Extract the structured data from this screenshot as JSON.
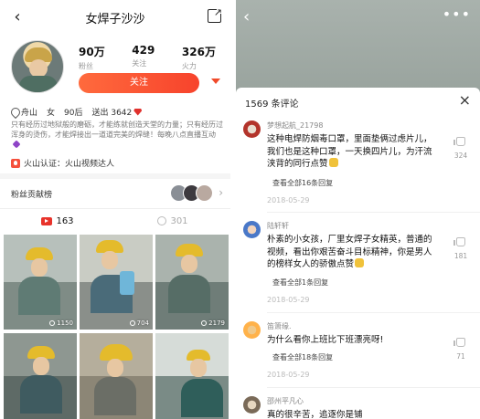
{
  "profile": {
    "nav_title": "女焊子沙沙",
    "stats": [
      {
        "num": "90万",
        "label": "粉丝"
      },
      {
        "num": "429",
        "label": "关注"
      },
      {
        "num": "326万",
        "label": "火力"
      }
    ],
    "follow_label": "关注",
    "info": {
      "location": "舟山",
      "gender": "女",
      "age": "90后",
      "sent": "送出 3642"
    },
    "bio": "只有经历过地狱般的磨砺，才能练就创造天堂的力量；只有经历过浑身的烫伤，才能焊接出一道道完美的焊缝！每晚八点直播互动",
    "cert": "火山认证：火山视频达人",
    "fans_label": "粉丝贡献榜",
    "tabs": [
      {
        "label": "163"
      },
      {
        "label": "301"
      }
    ],
    "thumbs": [
      {
        "count": "1150"
      },
      {
        "count": "704"
      },
      {
        "count": "2179"
      },
      {
        "count": ""
      },
      {
        "count": ""
      },
      {
        "count": ""
      }
    ]
  },
  "comments_panel": {
    "title": "1569 条评论",
    "comments": [
      {
        "user": "梦想起航_21798",
        "text": "这种电焊防烟毒口罩，里面垫俩过虑片儿，我们也是这种口罩，一天换四片儿，为汗流浃背的同行点赞",
        "reply": "查看全部16条回复",
        "time": "2018-05-29",
        "likes": "324"
      },
      {
        "user": "陆轩轩",
        "text": "朴素的小女孩，厂里女焊子女精英，普通的视频，看出你艰苦奋斗目标精神，你是男人的榜样女人的骄傲点赞",
        "reply": "查看全部1条回复",
        "time": "2018-05-29",
        "likes": "181"
      },
      {
        "user": "笛箫缘.",
        "text": "为什么看你上班比下班漂亮呀!",
        "reply": "查看全部18条回复",
        "time": "2018-05-29",
        "likes": "71"
      },
      {
        "user": "邵州平凡心",
        "text": "真的很辛苦，追逐你是铺",
        "reply": "",
        "time": "",
        "likes": ""
      }
    ]
  },
  "colors": {
    "accent": "#f7432c",
    "helmet": "#e4bb2c"
  }
}
